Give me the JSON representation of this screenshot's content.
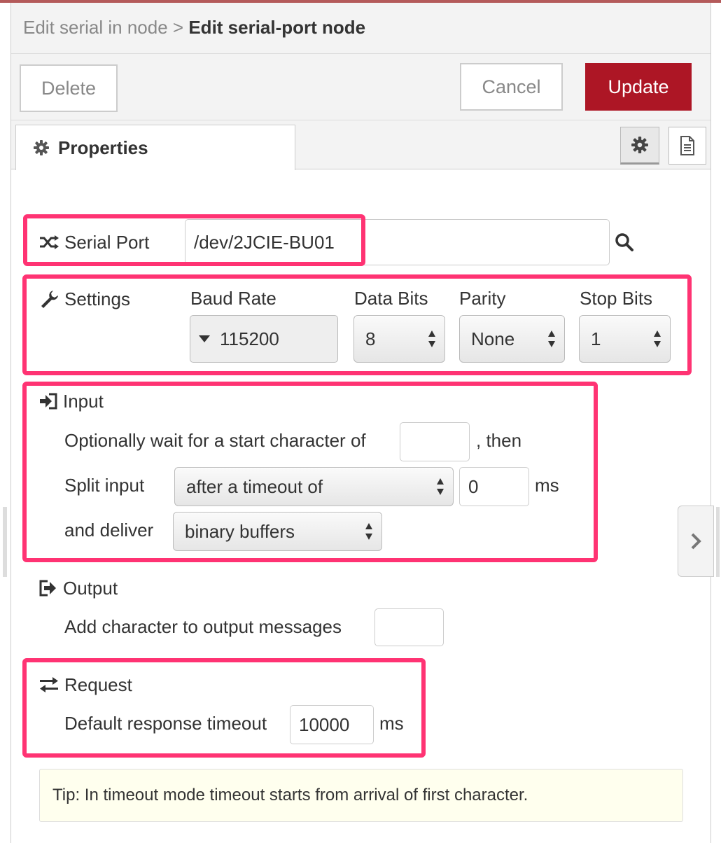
{
  "breadcrumb": {
    "parent": "Edit serial in node",
    "separator": ">",
    "current": "Edit serial-port node"
  },
  "toolbar": {
    "delete_label": "Delete",
    "cancel_label": "Cancel",
    "update_label": "Update"
  },
  "tabs": {
    "properties_label": "Properties"
  },
  "serial_port": {
    "label": "Serial Port",
    "value": "/dev/2JCIE-BU01"
  },
  "settings": {
    "label": "Settings",
    "baud_rate": {
      "label": "Baud Rate",
      "value": "115200"
    },
    "data_bits": {
      "label": "Data Bits",
      "value": "8"
    },
    "parity": {
      "label": "Parity",
      "value": "None"
    },
    "stop_bits": {
      "label": "Stop Bits",
      "value": "1"
    }
  },
  "input": {
    "label": "Input",
    "start_char_text": "Optionally wait for a start character of",
    "start_char_value": "",
    "then_text": ", then",
    "split_label": "Split input",
    "split_value": "after a timeout of",
    "timeout_value": "0",
    "timeout_unit": "ms",
    "deliver_label": "and deliver",
    "deliver_value": "binary buffers"
  },
  "output": {
    "label": "Output",
    "add_char_text": "Add character to output messages",
    "add_char_value": ""
  },
  "request": {
    "label": "Request",
    "timeout_text": "Default response timeout",
    "timeout_value": "10000",
    "timeout_unit": "ms"
  },
  "tip": "Tip: In timeout mode timeout starts from arrival of first character.",
  "colors": {
    "accent": "#ad1625",
    "highlight": "#ff3373",
    "tip_background": "#ffffee"
  },
  "icons": {
    "tab_properties": "gear-icon",
    "tab_button_1": "gear-icon",
    "tab_button_2": "document-icon",
    "serial_port": "shuffle-icon",
    "lookup": "search-icon",
    "settings": "wrench-icon",
    "input": "sign-in-icon",
    "output": "sign-out-icon",
    "request": "exchange-icon",
    "side_handle": "chevron-right-icon"
  }
}
